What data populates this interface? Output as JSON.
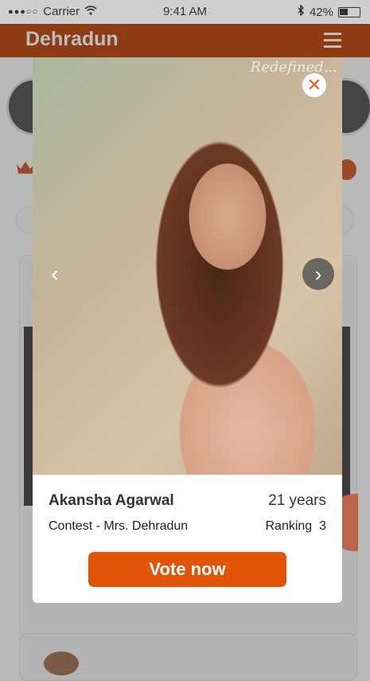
{
  "status_bar": {
    "signal_dots": "●●●○○",
    "carrier": "Carrier",
    "time": "9:41 AM",
    "battery_percent": "42%",
    "battery_level": 0.42
  },
  "app_bar": {
    "title": "Dehradun",
    "brand_color": "#8c3b12"
  },
  "modal": {
    "watermark": "Redefined...",
    "close_symbol": "✕",
    "prev_symbol": "‹",
    "next_symbol": "›",
    "contestant": {
      "name": "Akansha Agarwal",
      "age": "21 years",
      "contest": "Contest - Mrs. Dehradun",
      "ranking_label": "Ranking",
      "ranking_value": "3"
    },
    "vote_label": "Vote now",
    "accent_color": "#e25408"
  }
}
